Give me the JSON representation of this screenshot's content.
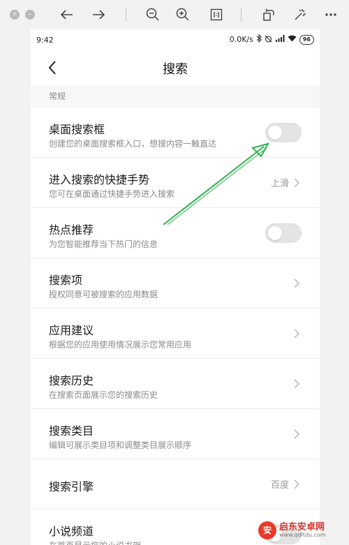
{
  "status_bar": {
    "time": "9:42",
    "network_speed": "0.0K/s",
    "battery": "96"
  },
  "header": {
    "title": "搜索"
  },
  "section": {
    "label": "常规"
  },
  "rows": [
    {
      "title": "桌面搜索框",
      "subtitle": "创建您的桌面搜索框入口，想搜内容一触直达",
      "control": "toggle",
      "checked": false
    },
    {
      "title": "进入搜索的快捷手势",
      "subtitle": "您可在桌面通过快捷手势进入搜索",
      "control": "chevron",
      "value": "上滑"
    },
    {
      "title": "热点推荐",
      "subtitle": "为您智能推荐当下热门的信息",
      "control": "toggle",
      "checked": false
    },
    {
      "title": "搜索项",
      "subtitle": "授权同意可被搜索的应用数据",
      "control": "chevron"
    },
    {
      "title": "应用建议",
      "subtitle": "根据您的应用使用情况展示您常用应用",
      "control": "chevron"
    },
    {
      "title": "搜索历史",
      "subtitle": "在搜索页面展示您的搜索历史",
      "control": "chevron"
    },
    {
      "title": "搜索类目",
      "subtitle": "编辑可展示类目项和调整类目展示顺序",
      "control": "chevron"
    },
    {
      "title": "搜索引擎",
      "subtitle": "",
      "control": "chevron",
      "value": "百度"
    },
    {
      "title": "小说频道",
      "subtitle": "在首页显示您的小说书架",
      "control": "toggle",
      "checked": false
    }
  ],
  "watermark": {
    "name": "启东安卓网",
    "url": "www.qdltdu.com"
  },
  "colors": {
    "annotation_arrow": "#2bb24c",
    "toggle_off": "#e4e4e4",
    "strip_yellow": "#f5e6a8",
    "strip_blue": "#b9d8ec",
    "strip_pink": "#efc3c8"
  }
}
